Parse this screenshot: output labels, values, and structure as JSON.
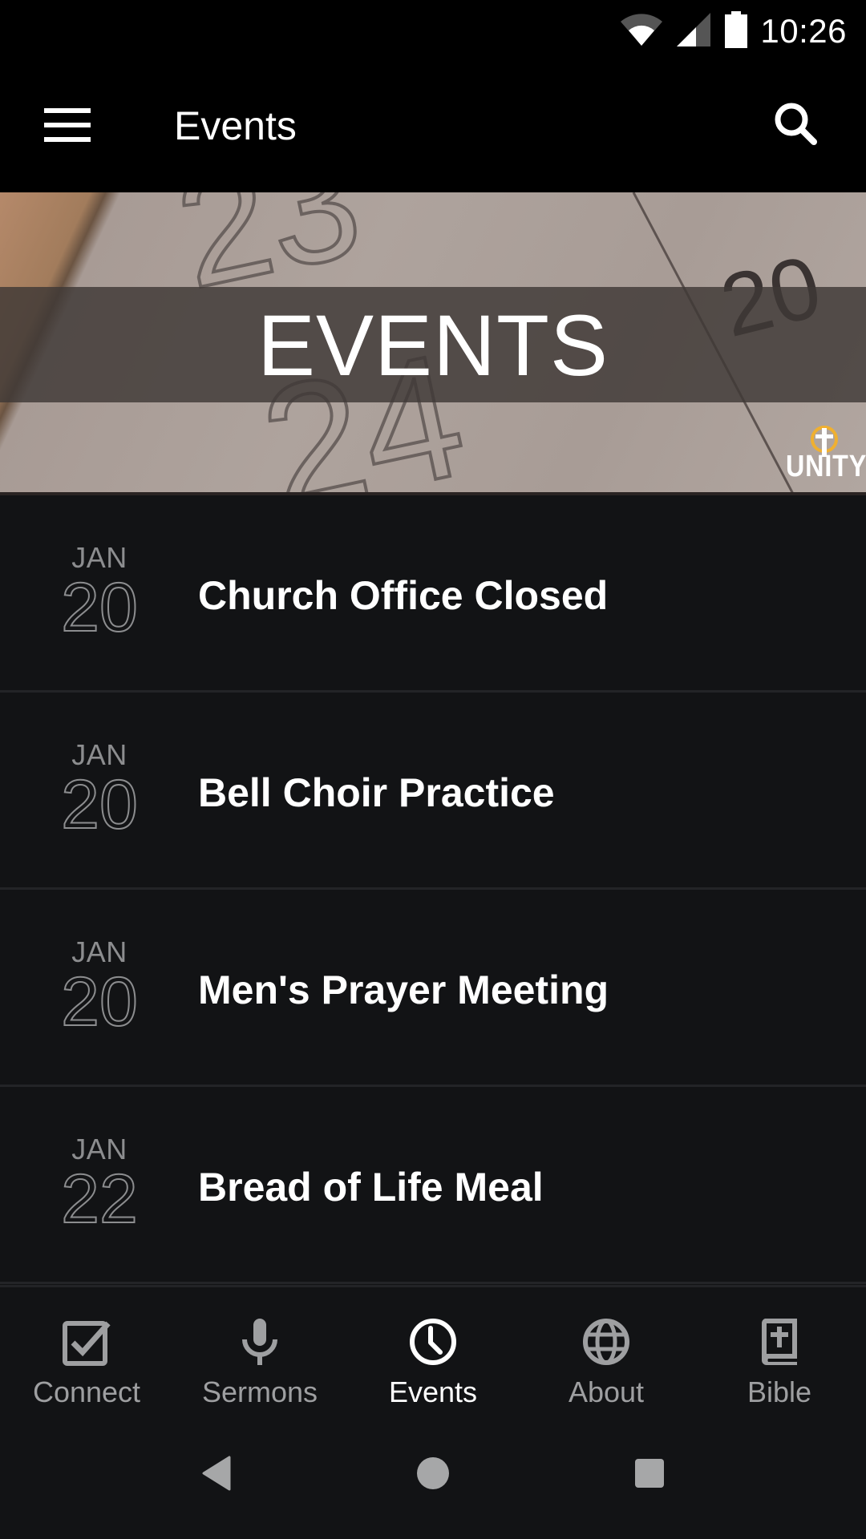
{
  "status_bar": {
    "time": "10:26",
    "icons": [
      "wifi-icon",
      "cell-signal-icon",
      "battery-icon"
    ]
  },
  "app_bar": {
    "title": "Events",
    "menu_icon": "hamburger-menu-icon",
    "search_icon": "search-icon"
  },
  "banner": {
    "title": "EVENTS",
    "logo_text": "UNITY",
    "bg_numbers": [
      "23",
      "24",
      "20"
    ]
  },
  "events": [
    {
      "month": "JAN",
      "day": "20",
      "title": "Church Office Closed"
    },
    {
      "month": "JAN",
      "day": "20",
      "title": "Bell Choir Practice"
    },
    {
      "month": "JAN",
      "day": "20",
      "title": "Men's Prayer Meeting"
    },
    {
      "month": "JAN",
      "day": "22",
      "title": "Bread of Life Meal"
    }
  ],
  "bottom_nav": {
    "active": "Events",
    "items": [
      {
        "label": "Connect",
        "icon": "checkbox-icon"
      },
      {
        "label": "Sermons",
        "icon": "microphone-icon"
      },
      {
        "label": "Events",
        "icon": "clock-icon"
      },
      {
        "label": "About",
        "icon": "globe-icon"
      },
      {
        "label": "Bible",
        "icon": "bible-icon"
      }
    ]
  },
  "system_nav": {
    "buttons": [
      "back",
      "home",
      "recents"
    ]
  },
  "colors": {
    "background": "#121315",
    "app_bar": "#000000",
    "active_nav": "#ffffff",
    "inactive_nav": "#9e9fa1",
    "date_text": "#8c8d8f",
    "divider": "#232427",
    "logo_accent": "#f0b030"
  }
}
